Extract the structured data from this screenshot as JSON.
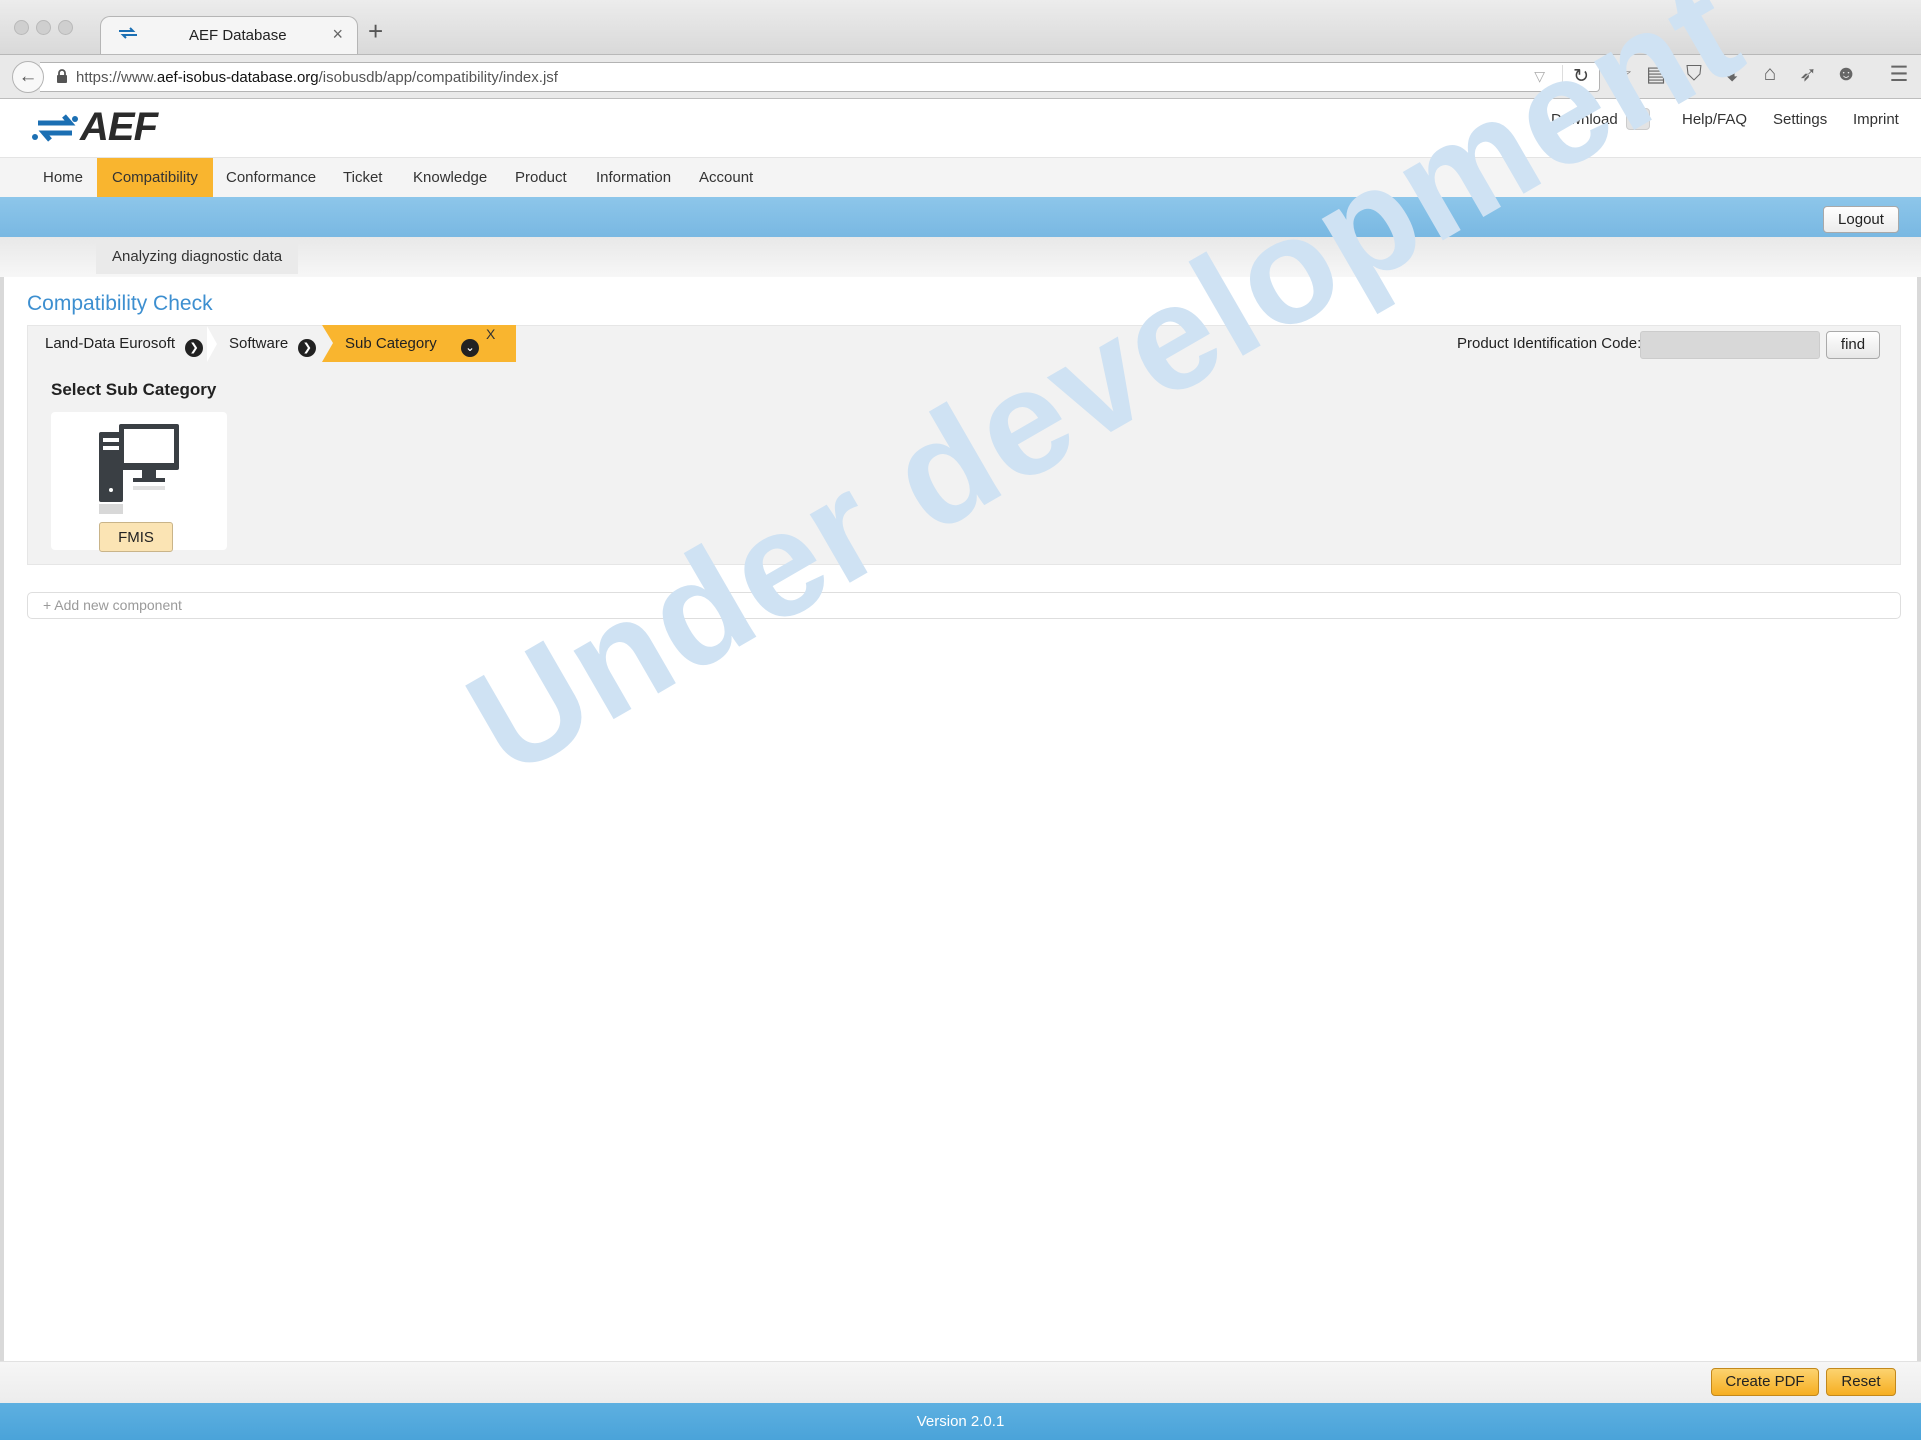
{
  "browser": {
    "tab_title": "AEF Database",
    "tab_close": "×",
    "new_tab": "+",
    "url_prefix": "https://www.",
    "url_domain": "aef-isobus-database.org",
    "url_path": "/isobusdb/app/compatibility/index.jsf",
    "icons": [
      "back-arrow-icon",
      "lock-icon",
      "dropdown-icon",
      "reload-icon",
      "star-icon",
      "reading-list-icon",
      "pocket-icon",
      "download-icon",
      "home-icon",
      "send-icon",
      "emoji-icon",
      "menu-icon"
    ]
  },
  "header": {
    "logo_text": "AEF",
    "links": {
      "download": "Download",
      "help": "Help/FAQ",
      "settings": "Settings",
      "imprint": "Imprint"
    },
    "brand_color": "#3d8fd0"
  },
  "nav": {
    "items": [
      "Home",
      "Compatibility",
      "Conformance",
      "Ticket",
      "Knowledge",
      "Product",
      "Information",
      "Account"
    ],
    "active": "Compatibility",
    "accent_color": "#f9b52f"
  },
  "toolbar": {
    "logout_label": "Logout"
  },
  "subnav": {
    "item": "Analyzing diagnostic data"
  },
  "main": {
    "title": "Compatibility Check",
    "breadcrumb": [
      "Land-Data Eurosoft",
      "Software",
      "Sub Category"
    ],
    "breadcrumb_close": "X",
    "pic_label": "Product Identification Code:",
    "pic_value": "",
    "find_label": "find",
    "section_label": "Select Sub Category",
    "tiles": [
      {
        "label": "FMIS",
        "icon": "computer-tower-icon"
      }
    ],
    "add_component": "+ Add new component",
    "watermark": "Under development"
  },
  "footer": {
    "create_pdf": "Create PDF",
    "reset": "Reset",
    "version": "Version 2.0.1"
  }
}
